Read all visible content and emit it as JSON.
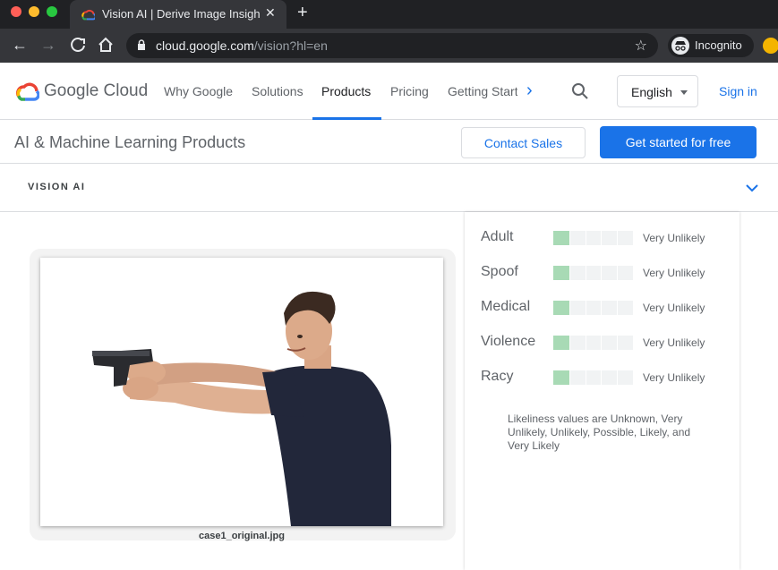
{
  "browser": {
    "tab_title": "Vision AI | Derive Image Insights via ML",
    "url_host": "cloud.google.com",
    "url_path": "/vision?hl=en",
    "incognito_label": "Incognito"
  },
  "header": {
    "logo_text": "Google Cloud",
    "nav": [
      "Why Google",
      "Solutions",
      "Products",
      "Pricing",
      "Getting Started"
    ],
    "active_nav": "Products",
    "language": "English",
    "sign_in": "Sign in"
  },
  "subheader": {
    "title": "AI & Machine Learning Products",
    "contact_sales": "Contact Sales",
    "get_started": "Get started for free"
  },
  "vision_bar": {
    "label": "VISION AI"
  },
  "image": {
    "caption": "case1_original.jpg"
  },
  "safe_search": {
    "rows": [
      {
        "label": "Adult",
        "value": "Very Unlikely",
        "level": 1
      },
      {
        "label": "Spoof",
        "value": "Very Unlikely",
        "level": 1
      },
      {
        "label": "Medical",
        "value": "Very Unlikely",
        "level": 1
      },
      {
        "label": "Violence",
        "value": "Very Unlikely",
        "level": 1
      },
      {
        "label": "Racy",
        "value": "Very Unlikely",
        "level": 1
      }
    ],
    "max_level": 5,
    "note": "Likeliness values are Unknown, Very Unlikely, Unlikely, Possible, Likely, and Very Likely"
  },
  "colors": {
    "accent": "#1a73e8",
    "meter_fill": "#a8dab5",
    "chrome_dark": "#202124"
  }
}
